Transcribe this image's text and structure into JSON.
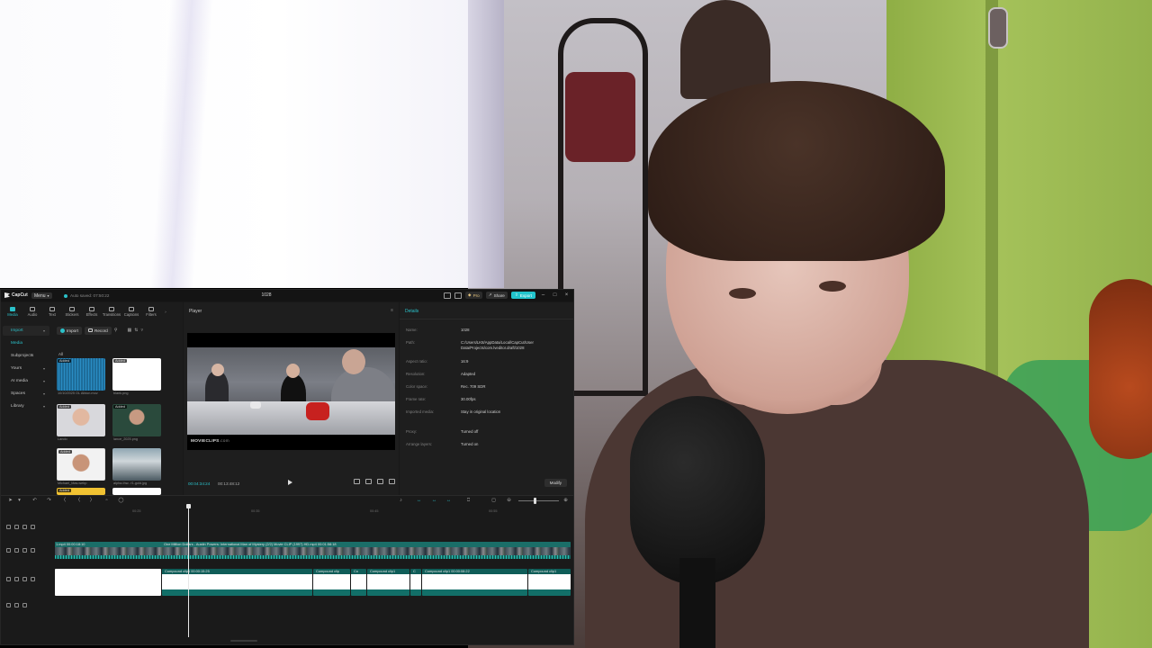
{
  "window": {
    "app_name": "CapCut",
    "menu_label": "Menu",
    "autosave_text": "Auto saved: 07:50:22",
    "project_title": "1028",
    "pro_label": "Pro",
    "share_label": "Share",
    "export_label": "Export"
  },
  "media_panel": {
    "tools": [
      {
        "label": "Media",
        "icon": "media-icon"
      },
      {
        "label": "Audio",
        "icon": "audio-icon"
      },
      {
        "label": "Text",
        "icon": "text-icon"
      },
      {
        "label": "Stickers",
        "icon": "stickers-icon"
      },
      {
        "label": "Effects",
        "icon": "effects-icon"
      },
      {
        "label": "Transitions",
        "icon": "transitions-icon"
      },
      {
        "label": "Captions",
        "icon": "captions-icon"
      },
      {
        "label": "Filters",
        "icon": "filters-icon"
      }
    ],
    "sidebar": [
      {
        "label": "Import"
      },
      {
        "label": "Media"
      },
      {
        "label": "Subprojects"
      },
      {
        "label": "Yours"
      },
      {
        "label": "AI media"
      },
      {
        "label": "Spaces"
      },
      {
        "label": "Library"
      }
    ],
    "import_label": "Import",
    "record_label": "Record",
    "filter_all": "All",
    "added_badge": "Added",
    "items": [
      {
        "name": "10/10/2025 OL Albion.mov",
        "added": true
      },
      {
        "name": "blank.png",
        "added": true
      },
      {
        "name": "Lando",
        "added": true
      },
      {
        "name": "lance_2025.png",
        "added": true
      },
      {
        "name": "Michael_Mas.webp",
        "added": true
      },
      {
        "name": "alpha-thw...f1-gold.jpg",
        "added": false
      },
      {
        "name": "",
        "added": true
      }
    ]
  },
  "player": {
    "title": "Player",
    "watermark": "MOVIECLIPS",
    "watermark_suffix": ".com",
    "current_time": "00:04:34:24",
    "total_time": "00:13:48:12"
  },
  "details": {
    "title": "Details",
    "rows": [
      {
        "label": "Name:",
        "value": "1028"
      },
      {
        "label": "Path:",
        "value": "C:/Users/LK8/AppData/Local/CapCut/User Data/Projects/com.lveditor.draft/1028"
      },
      {
        "label": "Aspect ratio:",
        "value": "16:9"
      },
      {
        "label": "Resolution:",
        "value": "Adapted"
      },
      {
        "label": "Color space:",
        "value": "Rec. 709 SDR"
      },
      {
        "label": "Frame rate:",
        "value": "30.00fps"
      },
      {
        "label": "Imported media:",
        "value": "Stay in original location"
      },
      {
        "label": "Proxy:",
        "value": "Turned off"
      },
      {
        "label": "Arrange layers:",
        "value": "Turned on"
      }
    ],
    "modify_label": "Modify"
  },
  "timeline": {
    "ruler": [
      "00:25",
      "00:35",
      "00:45",
      "00:55"
    ],
    "main_clip_left": "1.mp4  00:00:18:10",
    "main_clip_title": "One Million Dollars - Austin Powers: International Man of Mystery (2/2) Movie CLIP (1997) HD.mp4  00:01:58:18",
    "compound": [
      {
        "label": "Compound clip1  00:00:15:25"
      },
      {
        "label": "Compound clip"
      },
      {
        "label": "Co"
      },
      {
        "label": "Compound clip1"
      },
      {
        "label": "C"
      },
      {
        "label": "Compound clip1  00:00:08:22"
      },
      {
        "label": "Compound clip1"
      }
    ]
  },
  "colors": {
    "accent": "#22c4cc",
    "track_main": "#177c76",
    "panel_bg": "#1e1e1e"
  }
}
